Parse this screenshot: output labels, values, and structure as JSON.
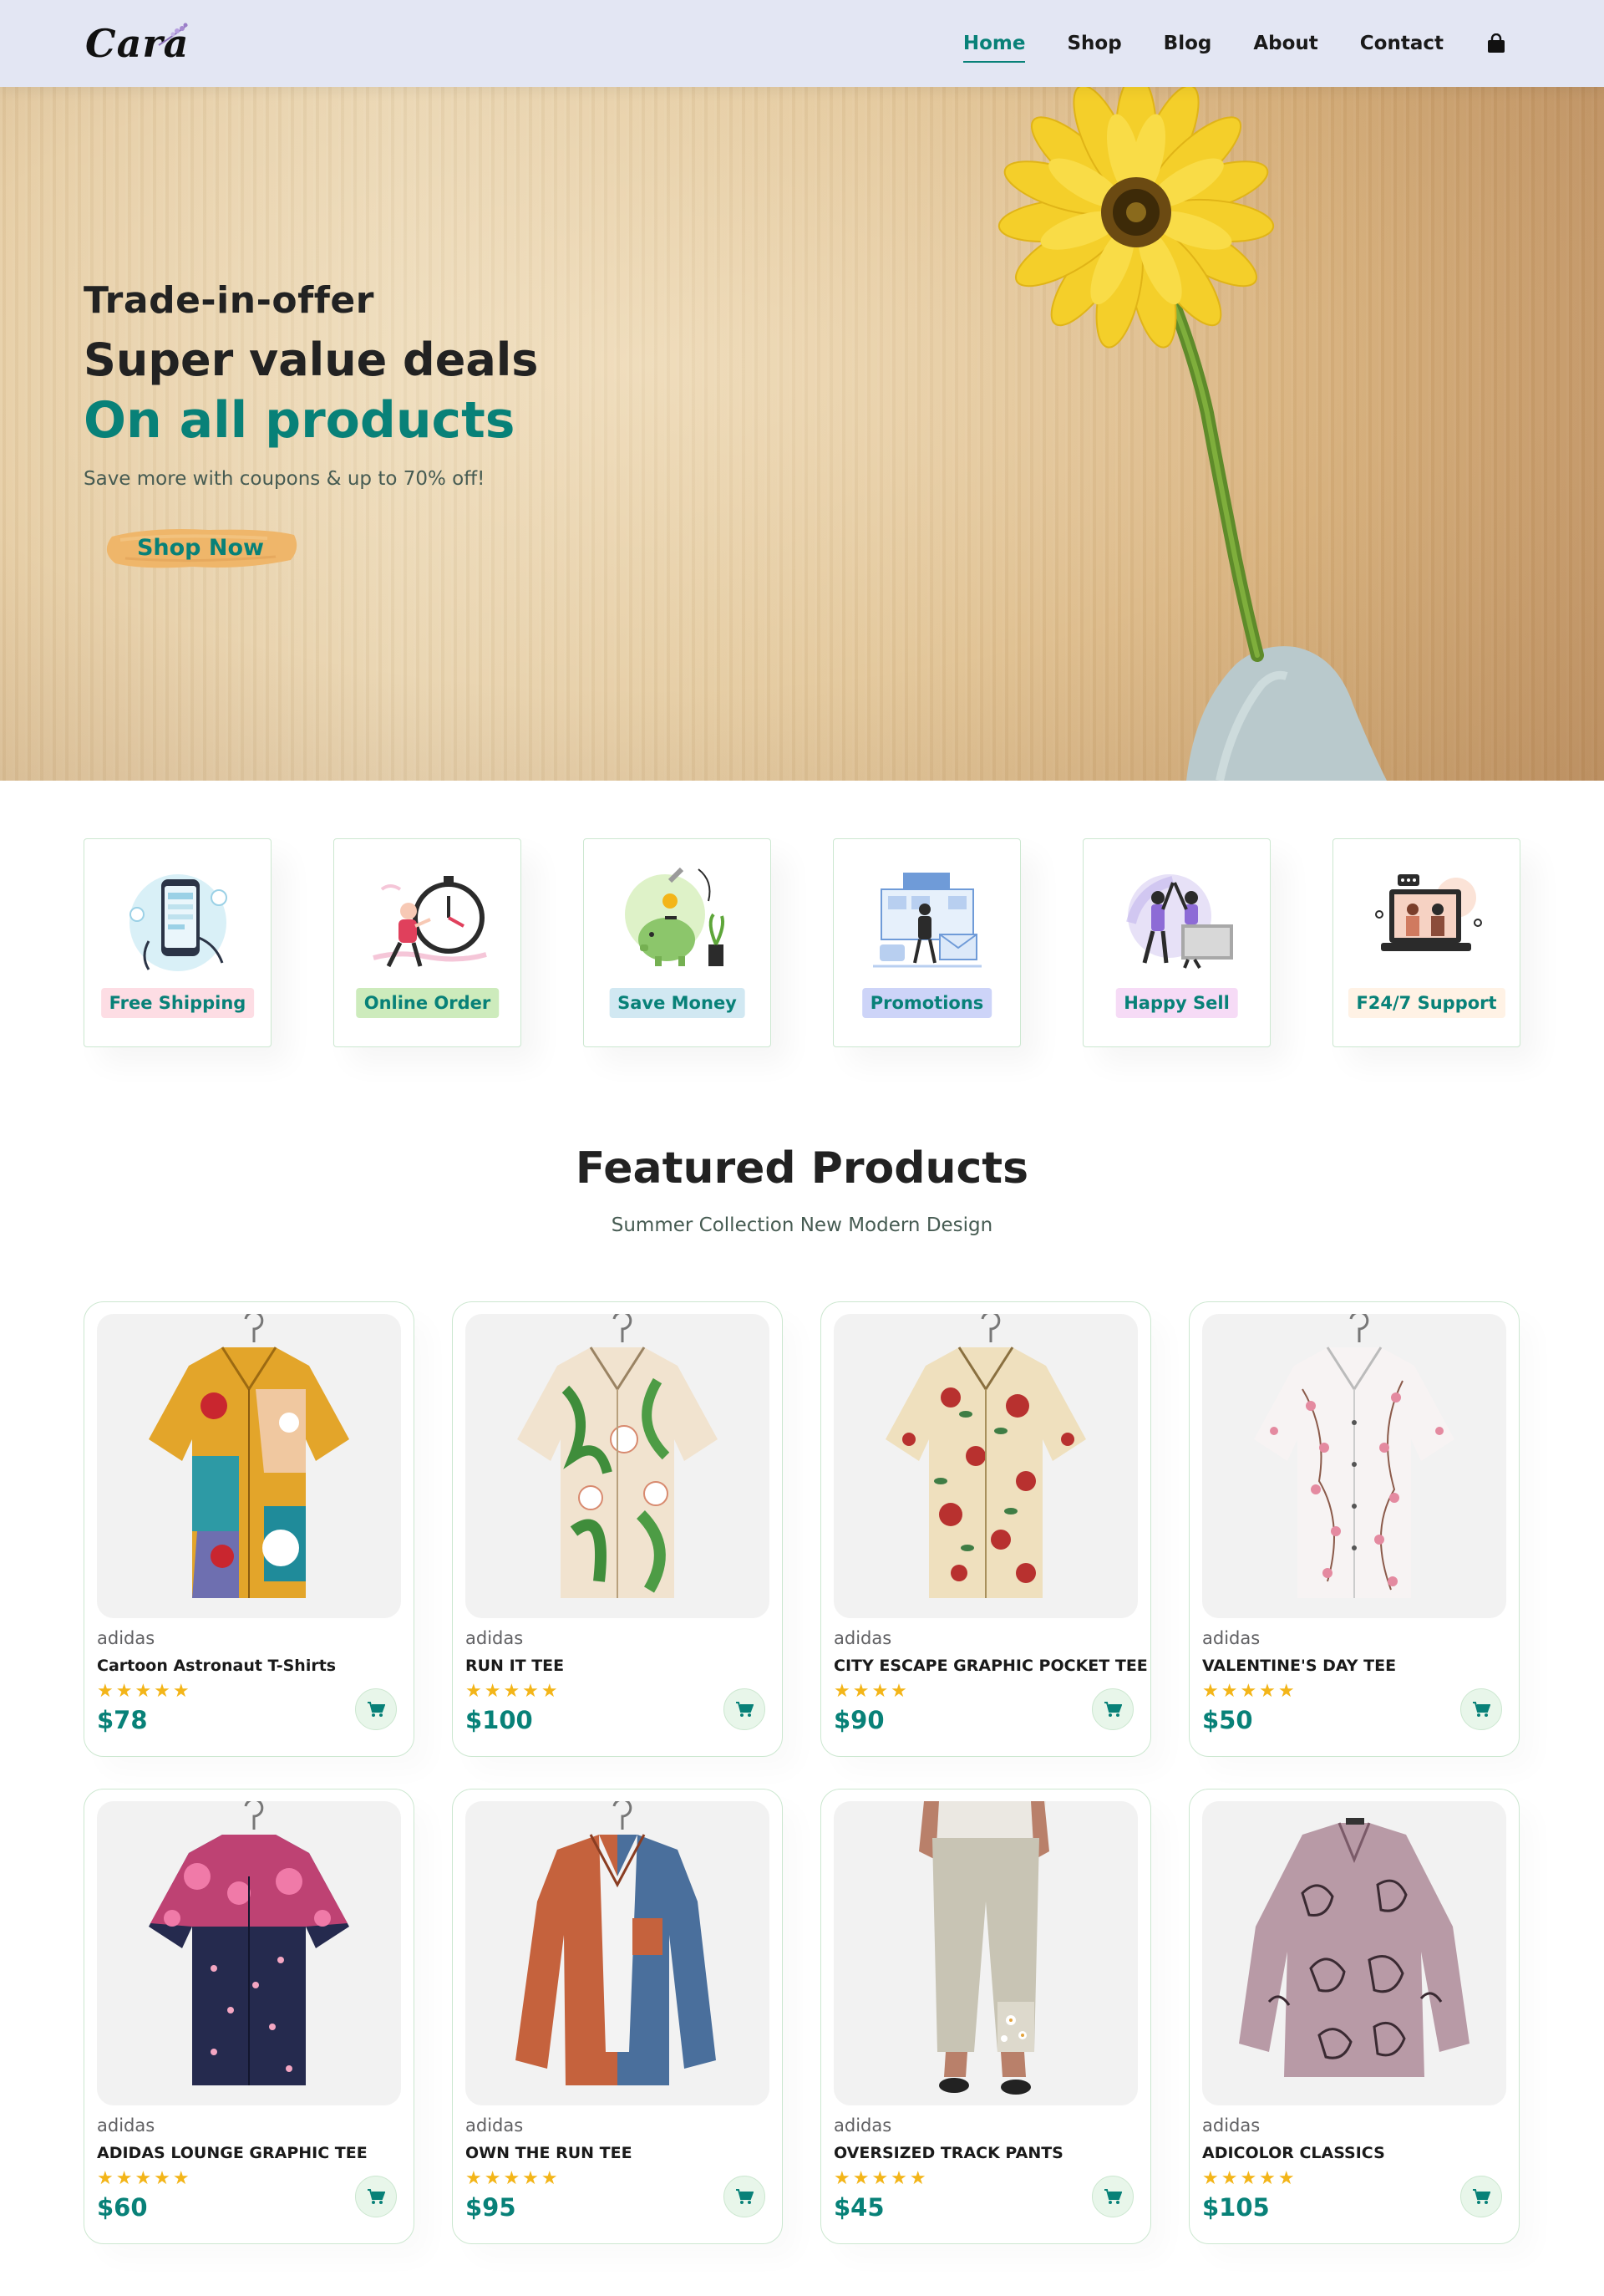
{
  "header": {
    "logo": "Cara",
    "nav": [
      "Home",
      "Shop",
      "Blog",
      "About",
      "Contact"
    ],
    "active": "Home"
  },
  "hero": {
    "eyebrow": "Trade-in-offer",
    "title": "Super value deals",
    "title_highlight": "On all products",
    "subtitle": "Save more with coupons & up to 70% off!",
    "button": "Shop Now"
  },
  "features": [
    {
      "label": "Free Shipping",
      "bg": "#fddde4"
    },
    {
      "label": "Online Order",
      "bg": "#cdebbc"
    },
    {
      "label": "Save Money",
      "bg": "#d1e8f2"
    },
    {
      "label": "Promotions",
      "bg": "#cdd4f8"
    },
    {
      "label": "Happy Sell",
      "bg": "#f6dbf6"
    },
    {
      "label": "F24/7 Support",
      "bg": "#fff2e5"
    }
  ],
  "featured": {
    "title": "Featured Products",
    "subtitle": "Summer Collection New Modern Design"
  },
  "products": [
    {
      "brand": "adidas",
      "name": "Cartoon Astronaut T-Shirts",
      "stars": "★★★★★",
      "price": "$78"
    },
    {
      "brand": "adidas",
      "name": "RUN IT TEE",
      "stars": "★★★★★",
      "price": "$100"
    },
    {
      "brand": "adidas",
      "name": "CITY ESCAPE GRAPHIC POCKET TEE",
      "stars": "★★★★",
      "price": "$90"
    },
    {
      "brand": "adidas",
      "name": "VALENTINE'S DAY TEE",
      "stars": "★★★★★",
      "price": "$50"
    },
    {
      "brand": "adidas",
      "name": "ADIDAS LOUNGE GRAPHIC TEE",
      "stars": "★★★★★",
      "price": "$60"
    },
    {
      "brand": "adidas",
      "name": "OWN THE RUN TEE",
      "stars": "★★★★★",
      "price": "$95"
    },
    {
      "brand": "adidas",
      "name": "OVERSIZED TRACK PANTS",
      "stars": "★★★★★",
      "price": "$45"
    },
    {
      "brand": "adidas",
      "name": "ADICOLOR CLASSICS",
      "stars": "★★★★★",
      "price": "$105"
    }
  ],
  "colors": {
    "accent": "#088178",
    "header_bg": "#e3e6f3",
    "star": "#f3b519"
  }
}
